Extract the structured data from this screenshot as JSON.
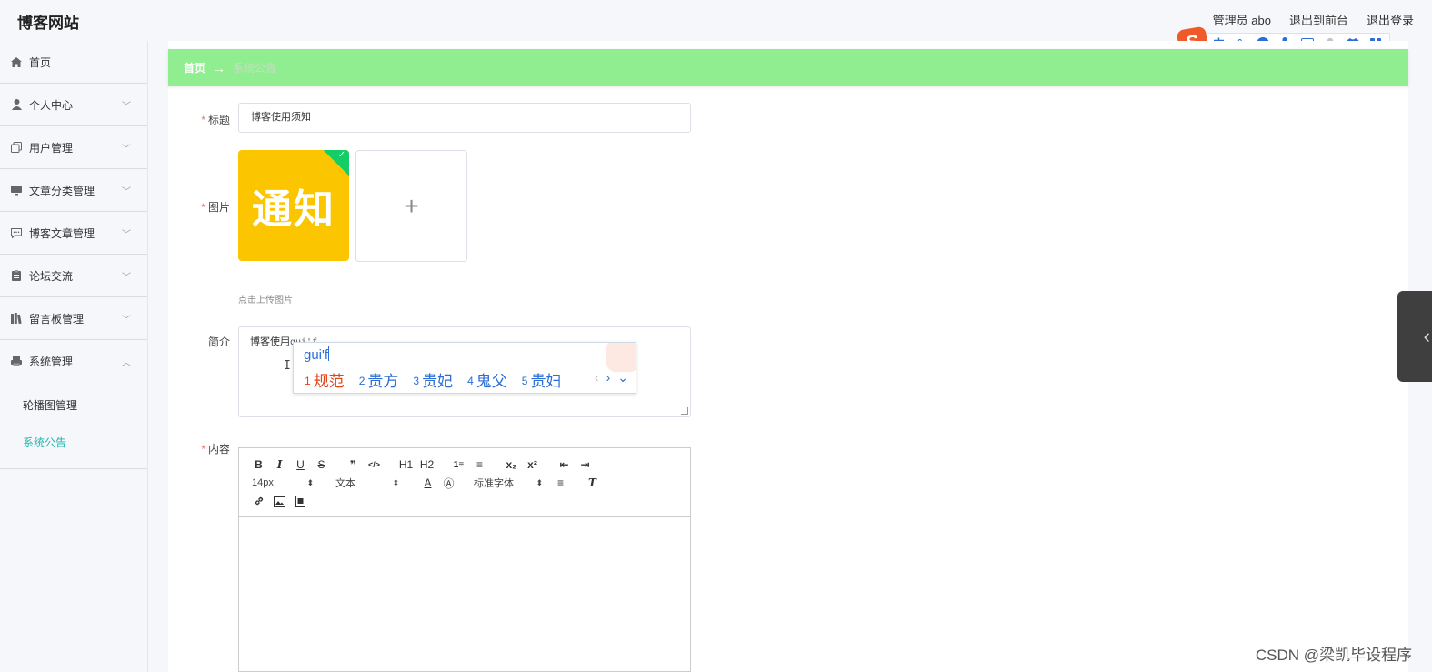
{
  "header": {
    "site_title": "博客网站",
    "admin_label": "管理员 abo",
    "back_to_front": "退出到前台",
    "logout": "退出登录"
  },
  "ime_bar": {
    "logo": "S",
    "buttons": [
      "中",
      "°,",
      "☺",
      "mic",
      "keyboard",
      "user",
      "shirt",
      "grid"
    ]
  },
  "sidebar": {
    "items": [
      {
        "label": "首页",
        "icon": "home-icon"
      },
      {
        "label": "个人中心",
        "icon": "user-icon"
      },
      {
        "label": "用户管理",
        "icon": "copy-icon"
      },
      {
        "label": "文章分类管理",
        "icon": "monitor-icon"
      },
      {
        "label": "博客文章管理",
        "icon": "chat-icon"
      },
      {
        "label": "论坛交流",
        "icon": "clipboard-icon"
      },
      {
        "label": "留言板管理",
        "icon": "books-icon"
      },
      {
        "label": "系统管理",
        "icon": "printer-icon"
      }
    ],
    "sub_items": [
      {
        "label": "轮播图管理"
      },
      {
        "label": "系统公告"
      }
    ]
  },
  "breadcrumb": {
    "home": "首页",
    "arrow": "→",
    "current": "系统公告"
  },
  "form": {
    "title_label": "标题",
    "title_value": "博客使用须知",
    "image_label": "图片",
    "image_text": "通知",
    "upload_plus": "+",
    "upload_hint": "点击上传图片",
    "intro_label": "简介",
    "intro_value": "博客使用",
    "intro_typing": "gui'f",
    "content_label": "内容"
  },
  "ime_popup": {
    "pinyin": "gui'f",
    "candidates": [
      {
        "num": "1",
        "text": "规范"
      },
      {
        "num": "2",
        "text": "贵方"
      },
      {
        "num": "3",
        "text": "贵妃"
      },
      {
        "num": "4",
        "text": "鬼父"
      },
      {
        "num": "5",
        "text": "贵妇"
      }
    ]
  },
  "editor": {
    "buttons_row1": [
      "B",
      "I",
      "U",
      "S",
      "❞",
      "</>",
      "H1",
      "H2",
      "1≡",
      "≡",
      "x₂",
      "x²",
      "⇤",
      "⇥"
    ],
    "font_size": "14px",
    "header_select": "文本",
    "font_family": "标准字体"
  },
  "watermark": "CSDN @梁凯毕设程序",
  "colors": {
    "breadcrumb_bg": "#90ee90",
    "active_menu": "#1fb5ad",
    "required": "#f56c6c",
    "image_bg": "#fbc500"
  }
}
